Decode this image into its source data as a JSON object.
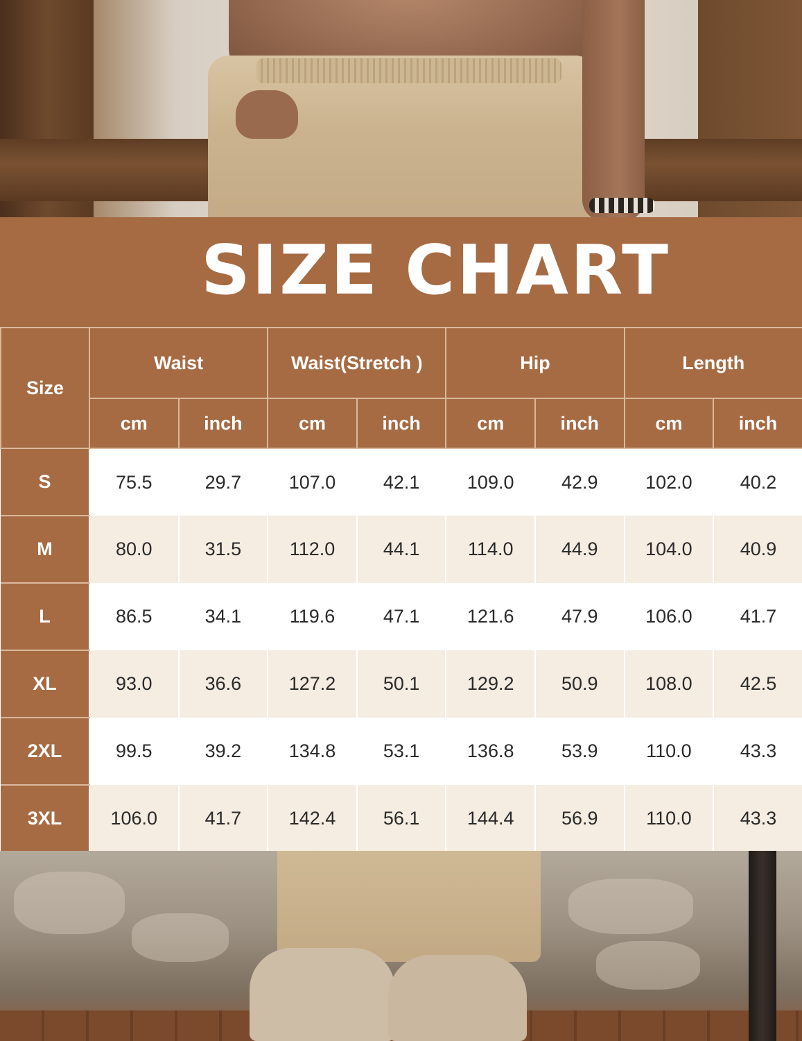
{
  "title": "SIZE CHART",
  "colors": {
    "brand_brown": "#a66b43",
    "row_alt": "#f5ece2",
    "row_white": "#ffffff"
  },
  "chart_data": {
    "type": "table",
    "title": "SIZE CHART",
    "row_header": "Size",
    "column_groups": [
      {
        "name": "Waist",
        "units": [
          "cm",
          "inch"
        ]
      },
      {
        "name": "Waist(Stretch )",
        "units": [
          "cm",
          "inch"
        ]
      },
      {
        "name": "Hip",
        "units": [
          "cm",
          "inch"
        ]
      },
      {
        "name": "Length",
        "units": [
          "cm",
          "inch"
        ]
      }
    ],
    "rows": [
      {
        "size": "S",
        "values": [
          "75.5",
          "29.7",
          "107.0",
          "42.1",
          "109.0",
          "42.9",
          "102.0",
          "40.2"
        ]
      },
      {
        "size": "M",
        "values": [
          "80.0",
          "31.5",
          "112.0",
          "44.1",
          "114.0",
          "44.9",
          "104.0",
          "40.9"
        ]
      },
      {
        "size": "L",
        "values": [
          "86.5",
          "34.1",
          "119.6",
          "47.1",
          "121.6",
          "47.9",
          "106.0",
          "41.7"
        ]
      },
      {
        "size": "XL",
        "values": [
          "93.0",
          "36.6",
          "127.2",
          "50.1",
          "129.2",
          "50.9",
          "108.0",
          "42.5"
        ]
      },
      {
        "size": "2XL",
        "values": [
          "99.5",
          "39.2",
          "134.8",
          "53.1",
          "136.8",
          "53.9",
          "110.0",
          "43.3"
        ]
      },
      {
        "size": "3XL",
        "values": [
          "106.0",
          "41.7",
          "142.4",
          "56.1",
          "144.4",
          "56.9",
          "110.0",
          "43.3"
        ]
      }
    ]
  }
}
